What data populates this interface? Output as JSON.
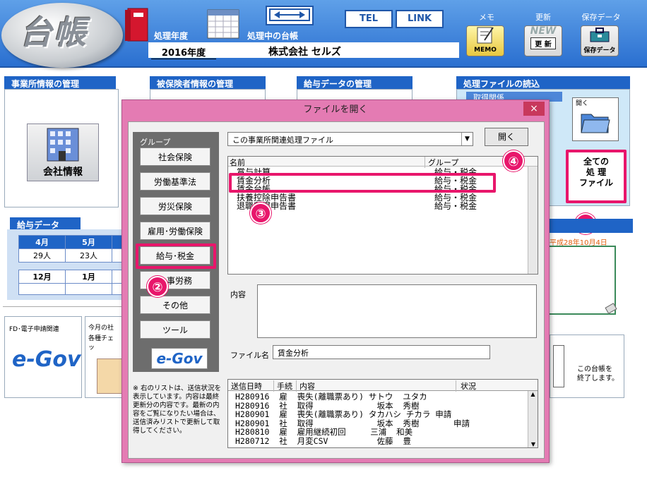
{
  "app": {
    "logo": "台帳"
  },
  "header": {
    "year_label": "処理年度",
    "year_value": "2016年度",
    "ledger_label": "処理中の台帳",
    "ledger_value": "株式会社 セルズ",
    "tel": "TEL",
    "link": "LINK",
    "memo_label": "メモ",
    "memo_icon_text": "MEMO",
    "update_label": "更新",
    "update_icon_new": "NEW",
    "update_icon_text": "更 新",
    "save_label": "保存データ",
    "save_icon_text": "保存データ"
  },
  "panels": {
    "office": "事業所情報の管理",
    "office_btn": "会社情報",
    "insured": "被保険者情報の管理",
    "payroll": "給与データの管理",
    "process": "処理ファイルの読込",
    "process_sub": "取得関係",
    "open_label": "開く",
    "all_files": [
      "全ての",
      "処 理",
      "ファイル"
    ],
    "date_text": "平成28年10月4日",
    "salary_title": "給与データ",
    "months1": [
      "4月",
      "5月"
    ],
    "counts1": [
      "29人",
      "23人"
    ],
    "months2": [
      "12月",
      "1月"
    ],
    "fd_label": "FD･電子申請関連",
    "monthly_label1": "今月の社",
    "monthly_label2": "各種チェッ",
    "egov": "e-Gov",
    "egov_small": "イーガブ",
    "exit_text1": "この台帳を",
    "exit_text2": "終了します。"
  },
  "dialog": {
    "title": "ファイルを開く",
    "close": "×",
    "group_label": "グループ",
    "groups": [
      "社会保険",
      "労働基準法",
      "労災保険",
      "雇用･労働保険",
      "給与･税金",
      "人事労務",
      "その他",
      "ツール"
    ],
    "dropdown_value": "この事業所関連処理ファイル",
    "open_button": "開く",
    "col_name": "名前",
    "col_group": "グループ",
    "files": [
      {
        "name": "賞与計算",
        "group": "給与・税金"
      },
      {
        "name": "賃金分析",
        "group": "給与・税金"
      },
      {
        "name": "賃金台帳",
        "group": "給与・税金"
      },
      {
        "name": "扶養控除申告書",
        "group": "給与・税金"
      },
      {
        "name": "退職所得申告書",
        "group": "給与・税金"
      }
    ],
    "content_label": "内容",
    "filename_label": "ファイル名",
    "filename_value": "賃金分析",
    "note": "※ 右のリストは、送信状況を表示しています。内容は最終更新分の内容です。最新の内容をご覧になりたい場合は、送信済みリストで更新して取得してください。",
    "sent_cols": [
      "送信日時",
      "手続",
      "内容",
      "状況"
    ],
    "sent_rows": [
      "H280916  雇  喪失(離職票あり) サトウ  ユタカ",
      "H280916  社  取得             坂本  秀樹",
      "H280901  雇  喪失(離職票あり) タカハシ チカラ 申請",
      "H280901  社  取得             坂本  秀樹       申請",
      "H280810  雇  雇用継続初回     三浦  和美",
      "H280712  社  月変CSV          佐藤  豊"
    ]
  },
  "badges": [
    "①",
    "②",
    "③",
    "④"
  ],
  "colors": {
    "accent": "#e8166b",
    "header_blue": "#2a6fd0",
    "dialog_pink": "#e47bb3"
  }
}
